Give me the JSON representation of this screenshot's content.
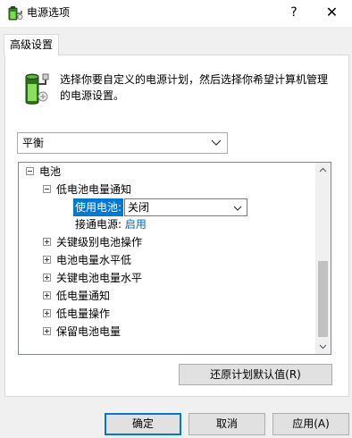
{
  "window": {
    "title": "电源选项",
    "help_glyph": "?",
    "close_glyph": "✕",
    "app_icon": "power-options-icon"
  },
  "tabs": [
    {
      "label": "高级设置",
      "active": true
    }
  ],
  "header": {
    "icon": "battery-plan-icon",
    "description": "选择你要自定义的电源计划，然后选择你希望计算机管理的电源设置。"
  },
  "plan_select": {
    "value": "平衡"
  },
  "tree": {
    "root": {
      "label": "电池",
      "expanded": true
    },
    "child": {
      "label": "低电池电量通知",
      "expanded": true
    },
    "settings": [
      {
        "label": "使用电池:",
        "value": "关闭",
        "selected": true
      },
      {
        "label": "接通电源:",
        "value": "启用"
      }
    ],
    "collapsed_items": [
      "关键级别电池操作",
      "电池电量水平低",
      "关键电池电量水平",
      "低电量通知",
      "低电量操作",
      "保留电池电量"
    ]
  },
  "buttons": {
    "restore": "还原计划默认值(R)",
    "ok": "确定",
    "cancel": "取消",
    "apply": "应用(A)"
  },
  "colors": {
    "selection": "#0078d7",
    "link": "#0066cc",
    "dialog_bg": "#f0f0f0"
  }
}
